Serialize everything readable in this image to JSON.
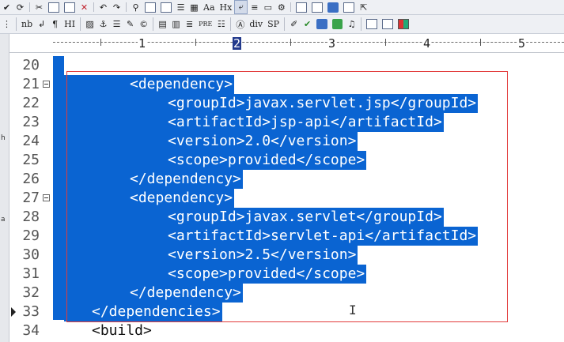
{
  "toolbar_top": {
    "items": [
      "Aa",
      "Hx"
    ]
  },
  "toolbar_format": {
    "nb": "nb",
    "pilcrow": "¶",
    "hi": "HI",
    "pre": "PRE",
    "div": "div",
    "sp": "SP"
  },
  "ruler": {
    "numbers": [
      "1",
      "2",
      "3",
      "4",
      "5"
    ],
    "current": "2"
  },
  "left_strip": {
    "chars": [
      "h",
      "a"
    ]
  },
  "editor": {
    "lines": [
      {
        "num": "20",
        "text": ""
      },
      {
        "num": "21",
        "text": "<dependency>"
      },
      {
        "num": "22",
        "text": "<groupId>javax.servlet.jsp</groupId>"
      },
      {
        "num": "23",
        "text": "<artifactId>jsp-api</artifactId>"
      },
      {
        "num": "24",
        "text": "<version>2.0</version>"
      },
      {
        "num": "25",
        "text": "<scope>provided</scope>"
      },
      {
        "num": "26",
        "text": "</dependency>"
      },
      {
        "num": "27",
        "text": "<dependency>"
      },
      {
        "num": "28",
        "text": "<groupId>javax.servlet</groupId>"
      },
      {
        "num": "29",
        "text": "<artifactId>servlet-api</artifactId>"
      },
      {
        "num": "30",
        "text": "<version>2.5</version>"
      },
      {
        "num": "31",
        "text": "<scope>provided</scope>"
      },
      {
        "num": "32",
        "text": "</dependency>"
      },
      {
        "num": "33",
        "text": "</dependencies>"
      },
      {
        "num": "34",
        "text": "<build>"
      }
    ]
  },
  "colors": {
    "selection": "#0a64d2",
    "annotation_box": "#e23b3b",
    "ruler_current": "#233a8c"
  }
}
